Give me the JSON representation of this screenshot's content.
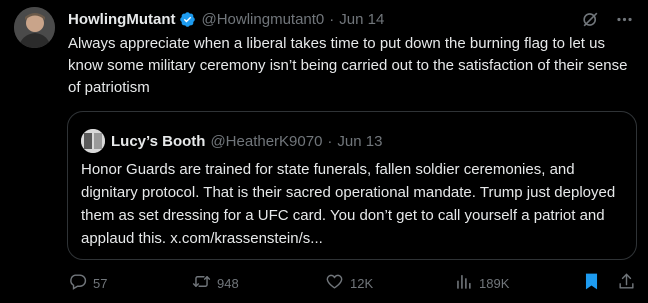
{
  "post": {
    "author": {
      "display_name": "HowlingMutant",
      "handle": "@Howlingmutant0",
      "separator": "·",
      "date": "Jun 14"
    },
    "text": "Always appreciate when a liberal takes time to put down the burning flag to let us know some military ceremony isn’t being carried out to the satisfaction of their sense of patriotism"
  },
  "quote": {
    "display_name": "Lucy’s Booth",
    "handle": "@HeatherK9070",
    "separator": "·",
    "date": "Jun 13",
    "text": "Honor Guards are trained for state funerals, fallen soldier ceremonies, and dignitary protocol. That is their sacred operational mandate. Trump just deployed them as set dressing for a UFC card. You don’t get to call yourself a patriot and applaud this. x.com/krassenstein/s..."
  },
  "actions": {
    "replies": "57",
    "reposts": "948",
    "likes": "12K",
    "views": "189K"
  },
  "colors": {
    "background": "#000000",
    "text": "#e7e9ea",
    "muted": "#71767b",
    "border": "#2f3336",
    "verified": "#1d9bf0",
    "bookmark": "#1d9bf0"
  },
  "icons": [
    "verified-badge-icon",
    "grok-icon",
    "more-icon",
    "reply-icon",
    "repost-icon",
    "like-icon",
    "views-icon",
    "bookmark-icon",
    "share-icon"
  ]
}
